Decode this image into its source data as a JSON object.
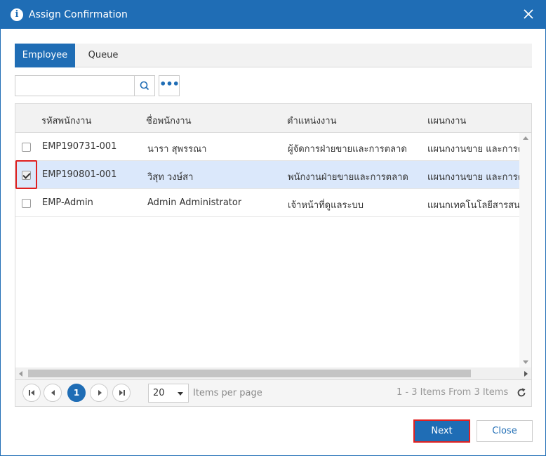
{
  "dialog": {
    "title": "Assign Confirmation",
    "colors": {
      "primary": "#1f6db5",
      "highlight": "#e02020",
      "selected_row": "#dbe8fb"
    }
  },
  "tabs": [
    {
      "label": "Employee",
      "active": true
    },
    {
      "label": "Queue",
      "active": false
    }
  ],
  "search": {
    "value": "",
    "placeholder": ""
  },
  "icons": {
    "search": "search-icon",
    "more": "more-icon",
    "close": "close-icon",
    "info": "info-icon",
    "refresh": "refresh-icon"
  },
  "table": {
    "columns": [
      "รหัสพนักงาน",
      "ชื่อพนักงาน",
      "ตำแหน่งงาน",
      "แผนกงาน"
    ],
    "rows": [
      {
        "checked": false,
        "code": "EMP190731-001",
        "name": "นารา สุพรรณา",
        "position": "ผู้จัดการฝ่ายขายและการตลาด",
        "department": "แผนกงานขาย และการตล"
      },
      {
        "checked": true,
        "code": "EMP190801-001",
        "name": "วิสุท วงษ์สา",
        "position": "พนักงานฝ่ายขายและการตลาด",
        "department": "แผนกงานขาย และการตล"
      },
      {
        "checked": false,
        "code": "EMP-Admin",
        "name": "Admin Administrator",
        "position": "เจ้าหน้าที่ดูแลระบบ",
        "department": "แผนกเทคโนโลยีสารสนเ"
      }
    ]
  },
  "pager": {
    "current_page": "1",
    "page_size": "20",
    "items_per_page_label": "Items per page",
    "info": "1 - 3 Items From 3 Items"
  },
  "buttons": {
    "next": "Next",
    "close": "Close"
  }
}
